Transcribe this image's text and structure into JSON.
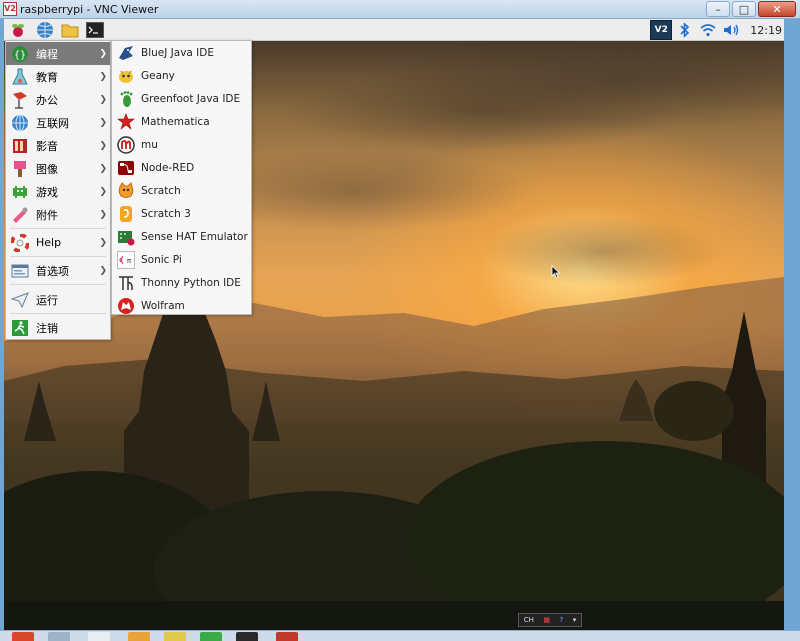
{
  "window": {
    "title": "raspberrypi - VNC Viewer",
    "logo_text": "V2",
    "controls": {
      "minimize": "–",
      "maximize": "□",
      "close": "✕"
    }
  },
  "panel": {
    "clock": "12:19",
    "tray_vnc_text": "V2"
  },
  "main_menu": {
    "items": [
      {
        "label": "编程",
        "icon": "code-braces-icon",
        "has_submenu": true
      },
      {
        "label": "教育",
        "icon": "education-flask-icon",
        "has_submenu": true
      },
      {
        "label": "办公",
        "icon": "office-icon",
        "has_submenu": true
      },
      {
        "label": "互联网",
        "icon": "globe-icon",
        "has_submenu": true
      },
      {
        "label": "影音",
        "icon": "film-icon",
        "has_submenu": true
      },
      {
        "label": "图像",
        "icon": "paintbrush-icon",
        "has_submenu": true
      },
      {
        "label": "游戏",
        "icon": "space-invader-icon",
        "has_submenu": true
      },
      {
        "label": "附件",
        "icon": "accessories-icon",
        "has_submenu": true
      },
      {
        "label": "Help",
        "icon": "lifebuoy-icon",
        "has_submenu": true
      },
      {
        "label": "首选项",
        "icon": "preferences-icon",
        "has_submenu": true
      },
      {
        "label": "运行",
        "icon": "paper-plane-icon",
        "has_submenu": false
      },
      {
        "label": "注销",
        "icon": "logout-runner-icon",
        "has_submenu": false
      }
    ]
  },
  "sub_menu": {
    "items": [
      {
        "label": "BlueJ Java IDE",
        "icon": "bluej-icon"
      },
      {
        "label": "Geany",
        "icon": "geany-icon"
      },
      {
        "label": "Greenfoot Java IDE",
        "icon": "greenfoot-icon"
      },
      {
        "label": "Mathematica",
        "icon": "mathematica-icon"
      },
      {
        "label": "mu",
        "icon": "mu-icon"
      },
      {
        "label": "Node-RED",
        "icon": "node-red-icon"
      },
      {
        "label": "Scratch",
        "icon": "scratch-icon"
      },
      {
        "label": "Scratch 3",
        "icon": "scratch3-icon"
      },
      {
        "label": "Sense HAT Emulator",
        "icon": "sense-hat-icon"
      },
      {
        "label": "Sonic Pi",
        "icon": "sonic-pi-icon"
      },
      {
        "label": "Thonny Python IDE",
        "icon": "thonny-icon"
      },
      {
        "label": "Wolfram",
        "icon": "wolfram-icon"
      }
    ]
  },
  "vnc_toolbar": {
    "label": "CH"
  },
  "colors": {
    "menu_highlight": "#7a7a7a",
    "panel_bg": "#ededed",
    "raspberry": "#c51a4a",
    "vnc_close": "#c8432b"
  }
}
